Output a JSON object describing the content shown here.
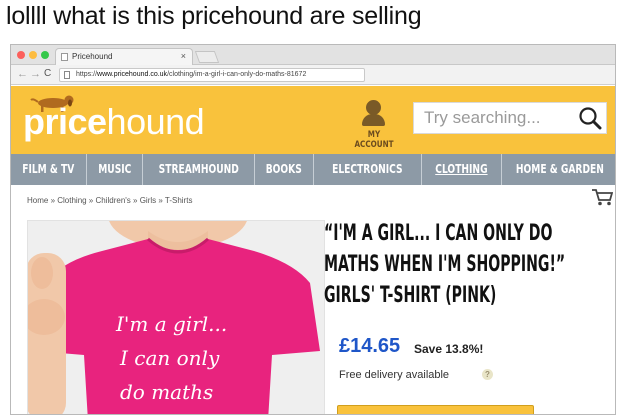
{
  "caption": "lollll what is this pricehound are selling",
  "browser": {
    "tab_title": "Pricehound",
    "tab_close": "×",
    "back": "←",
    "forward": "→",
    "reload": "C",
    "url_scheme": "https://",
    "url_host": "www.pricehound.co.uk",
    "url_path": "/clothing/im-a-girl-i-can-only-do-maths-81672"
  },
  "header": {
    "logo_bold": "price",
    "logo_light": "hound",
    "account_label": "MY ACCOUNT",
    "search_placeholder": "Try searching..."
  },
  "nav": {
    "items": [
      {
        "label": "FILM & TV"
      },
      {
        "label": "MUSIC"
      },
      {
        "label": "STREAMHOUND"
      },
      {
        "label": "BOOKS"
      },
      {
        "label": "ELECTRONICS"
      },
      {
        "label": "CLOTHING",
        "active": true
      },
      {
        "label": "HOME & GARDEN"
      }
    ]
  },
  "breadcrumb": "Home » Clothing » Children's » Girls » T-Shirts",
  "product": {
    "title_lines": [
      "“I'M A GIRL... I CAN ONLY DO",
      "MATHS WHEN I'M SHOPPING!”",
      "GIRLS' T-SHIRT (PINK)"
    ],
    "price": "£14.65",
    "save": "Save 13.8%!",
    "delivery": "Free delivery available",
    "info_icon": "?",
    "shirt_text": [
      "I'm a girl...",
      "I can only",
      "do maths"
    ]
  },
  "colors": {
    "brand_yellow": "#f9c23c",
    "nav_grey": "#8d9aa6",
    "price_blue": "#1f56c8",
    "shirt_pink": "#e8237e"
  }
}
